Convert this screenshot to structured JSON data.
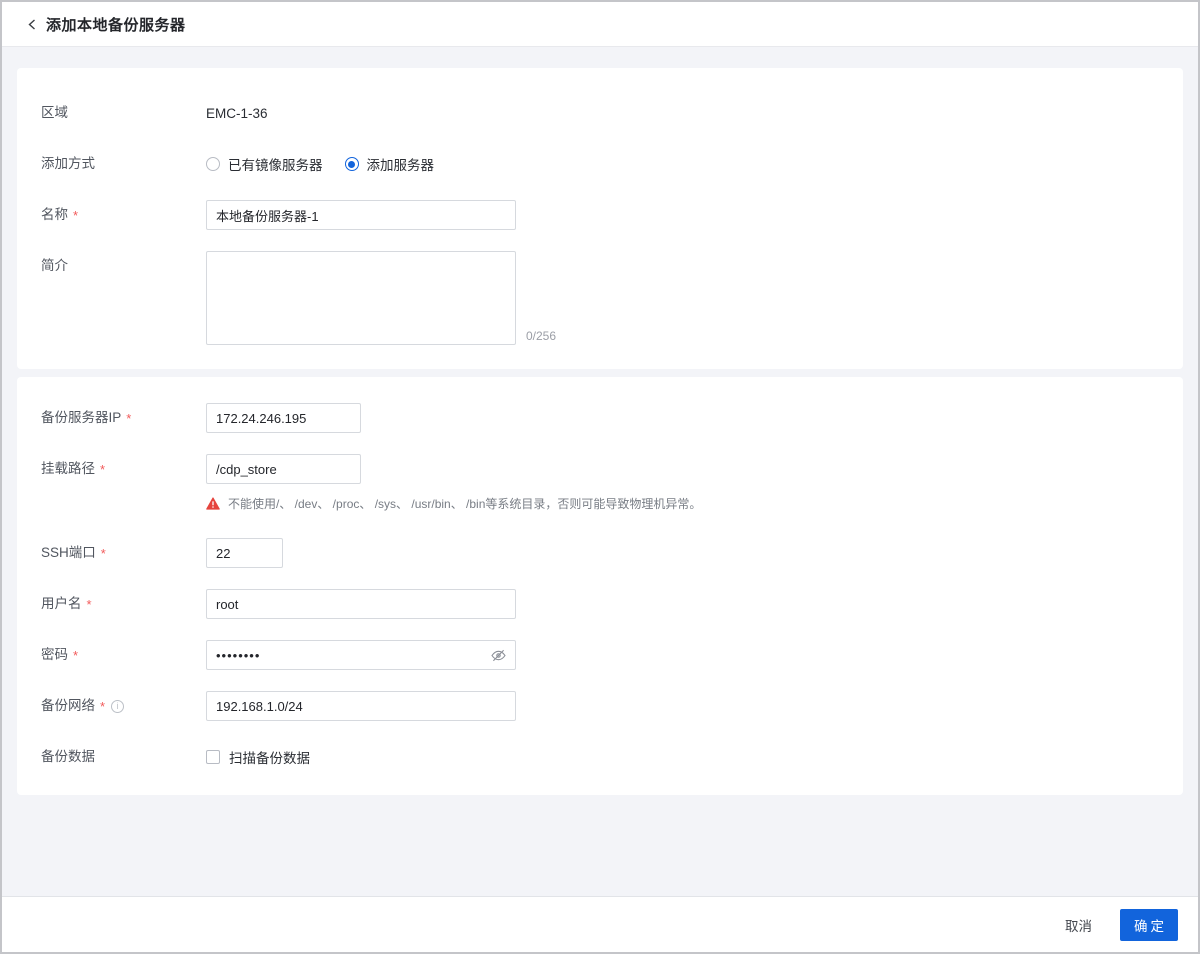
{
  "header": {
    "title": "添加本地备份服务器"
  },
  "required_mark": "*",
  "section_basic": {
    "region": {
      "label": "区域",
      "value": "EMC-1-36"
    },
    "add_method": {
      "label": "添加方式",
      "options": [
        {
          "label": "已有镜像服务器",
          "selected": false
        },
        {
          "label": "添加服务器",
          "selected": true
        }
      ]
    },
    "name": {
      "label": "名称",
      "value": "本地备份服务器-1"
    },
    "description": {
      "label": "简介",
      "value": "",
      "counter": "0/256"
    }
  },
  "section_server": {
    "backup_ip": {
      "label": "备份服务器IP",
      "value": "172.24.246.195"
    },
    "mount_path": {
      "label": "挂载路径",
      "value": "/cdp_store",
      "warning": "不能使用/、 /dev、 /proc、 /sys、 /usr/bin、 /bin等系统目录，否则可能导致物理机异常。"
    },
    "ssh_port": {
      "label": "SSH端口",
      "value": "22"
    },
    "username": {
      "label": "用户名",
      "value": "root"
    },
    "password": {
      "label": "密码",
      "value": "••••••••"
    },
    "backup_network": {
      "label": "备份网络",
      "value": "192.168.1.0/24"
    },
    "backup_data": {
      "label": "备份数据",
      "checkbox_label": "扫描备份数据",
      "checked": false
    }
  },
  "footer": {
    "cancel_label": "取消",
    "confirm_label": "确定"
  },
  "colors": {
    "primary": "#1264dc",
    "danger": "#e5443e",
    "page_background": "#f3f4f8"
  }
}
